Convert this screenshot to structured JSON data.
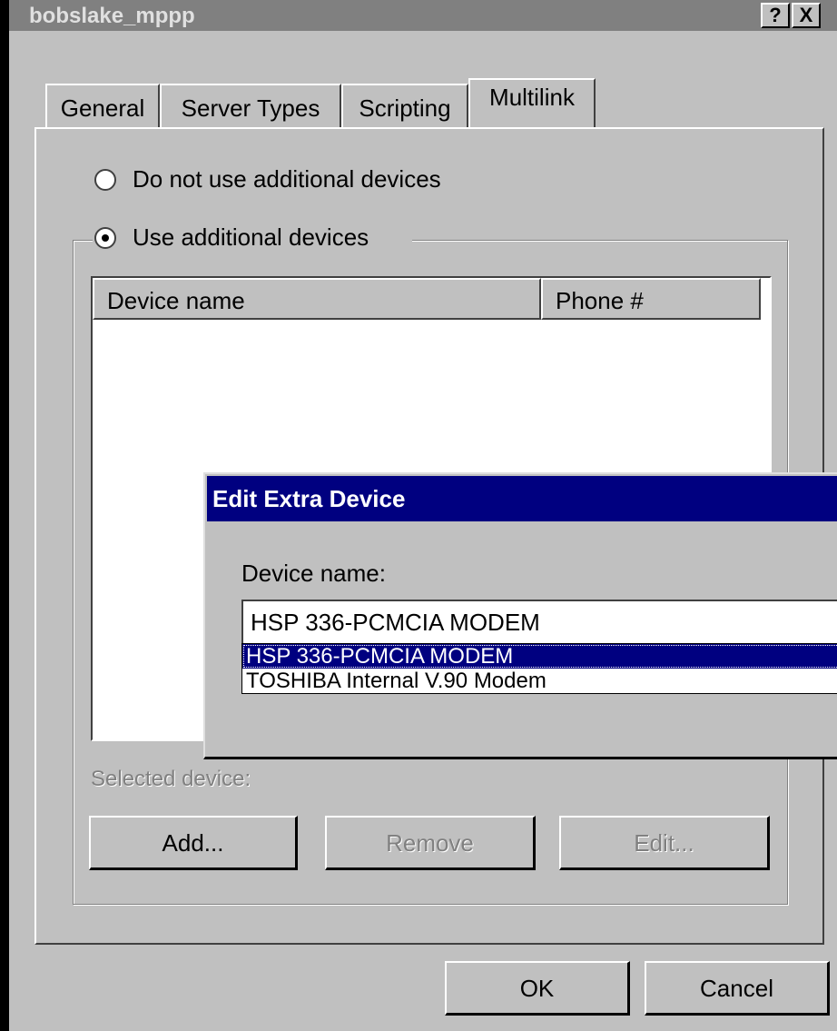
{
  "window": {
    "title": "bobslake_mppp",
    "help_button": "?",
    "close_button": "X"
  },
  "tabs": [
    {
      "label": "General"
    },
    {
      "label": "Server Types"
    },
    {
      "label": "Scripting"
    },
    {
      "label": "Multilink"
    }
  ],
  "multilink": {
    "radio_no_additional": "Do not use additional devices",
    "radio_use_additional": "Use additional devices",
    "selected_radio": "Use additional devices",
    "list_columns": [
      "Device name",
      "Phone #"
    ],
    "selected_device_label": "Selected device:",
    "add_button": "Add...",
    "remove_button": "Remove",
    "edit_button": "Edit..."
  },
  "footer": {
    "ok_button": "OK",
    "cancel_button": "Cancel"
  },
  "edit_dialog": {
    "title": "Edit Extra Device",
    "device_name_label": "Device name:",
    "device_name_value": "HSP 336-PCMCIA MODEM",
    "options": [
      {
        "label": "HSP 336-PCMCIA MODEM",
        "selected": true
      },
      {
        "label": "TOSHIBA Internal V.90 Modem",
        "selected": false
      }
    ]
  },
  "colors": {
    "face": "#c0c0c0",
    "inactive_title": "#808080",
    "active_title": "#000080"
  }
}
